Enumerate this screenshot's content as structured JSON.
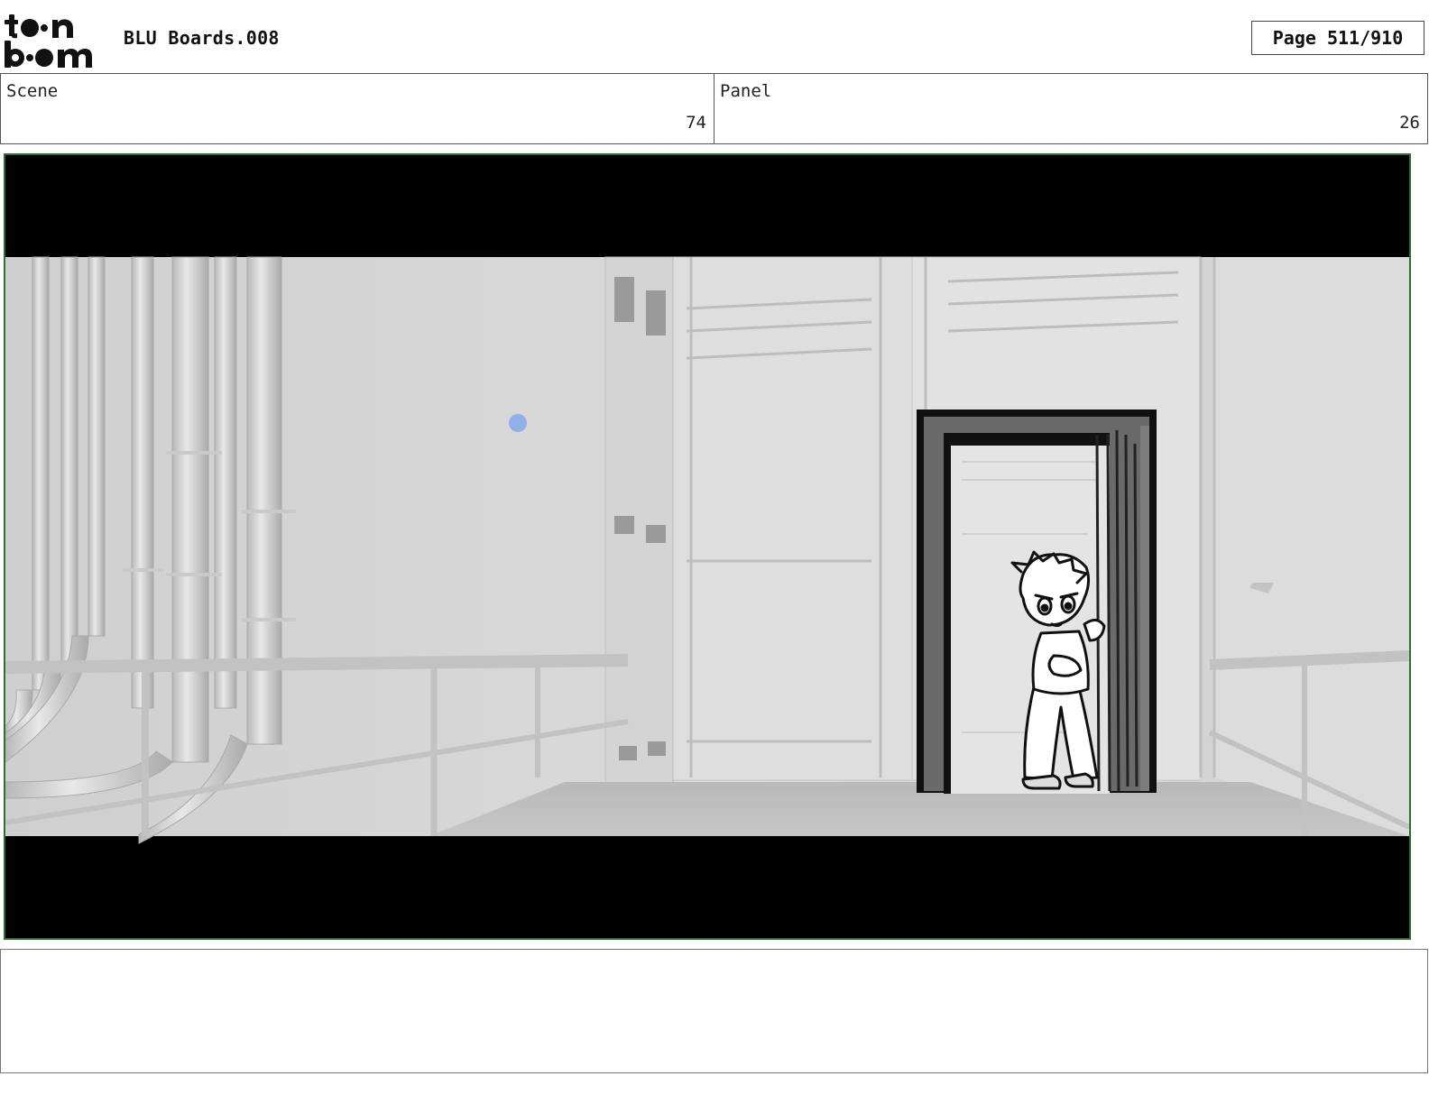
{
  "header": {
    "logo_text": "toon boom",
    "project_title": "BLU Boards.008",
    "page_label": "Page 511/910"
  },
  "scene": {
    "label": "Scene",
    "value": "74"
  },
  "panel": {
    "label": "Panel",
    "value": "26"
  },
  "notes": {
    "text": ""
  },
  "colors": {
    "frame_border": "#2f6f2f",
    "letterbox": "#000000",
    "marker_dot": "#8fb0e8"
  }
}
